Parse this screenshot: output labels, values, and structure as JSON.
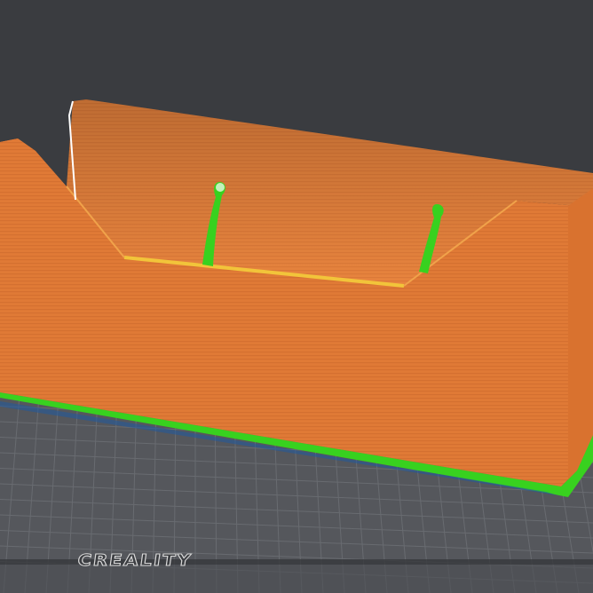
{
  "bed": {
    "logo_text": "CREALITY"
  },
  "colors": {
    "background": "#3a3c40",
    "bed_surface": "#55575c",
    "bed_grid": "#6b6e73",
    "wall": "#e07a36",
    "wall_shadow": "#b85f25",
    "wall_highlight": "#f09a55",
    "rim": "#f2c43a",
    "support": "#38d11f",
    "bed_edge": "#2a2b2e"
  },
  "icons": {
    "bed_logo": "creality-logo"
  }
}
